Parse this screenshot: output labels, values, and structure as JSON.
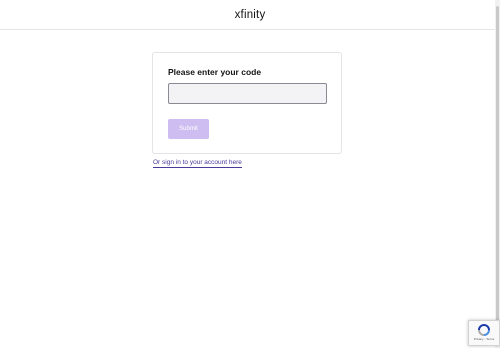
{
  "header": {
    "brand": "xfinity"
  },
  "card": {
    "title": "Please enter your code",
    "code_input": {
      "value": "",
      "placeholder": ""
    },
    "submit_label": "Submit"
  },
  "alt_link": "Or sign in to your account here",
  "recaptcha": {
    "terms": "Privacy - Terms"
  },
  "colors": {
    "submit_disabled": "#cdbdf0",
    "link": "#4a3a9a",
    "input_background": "#f3f3f5"
  }
}
